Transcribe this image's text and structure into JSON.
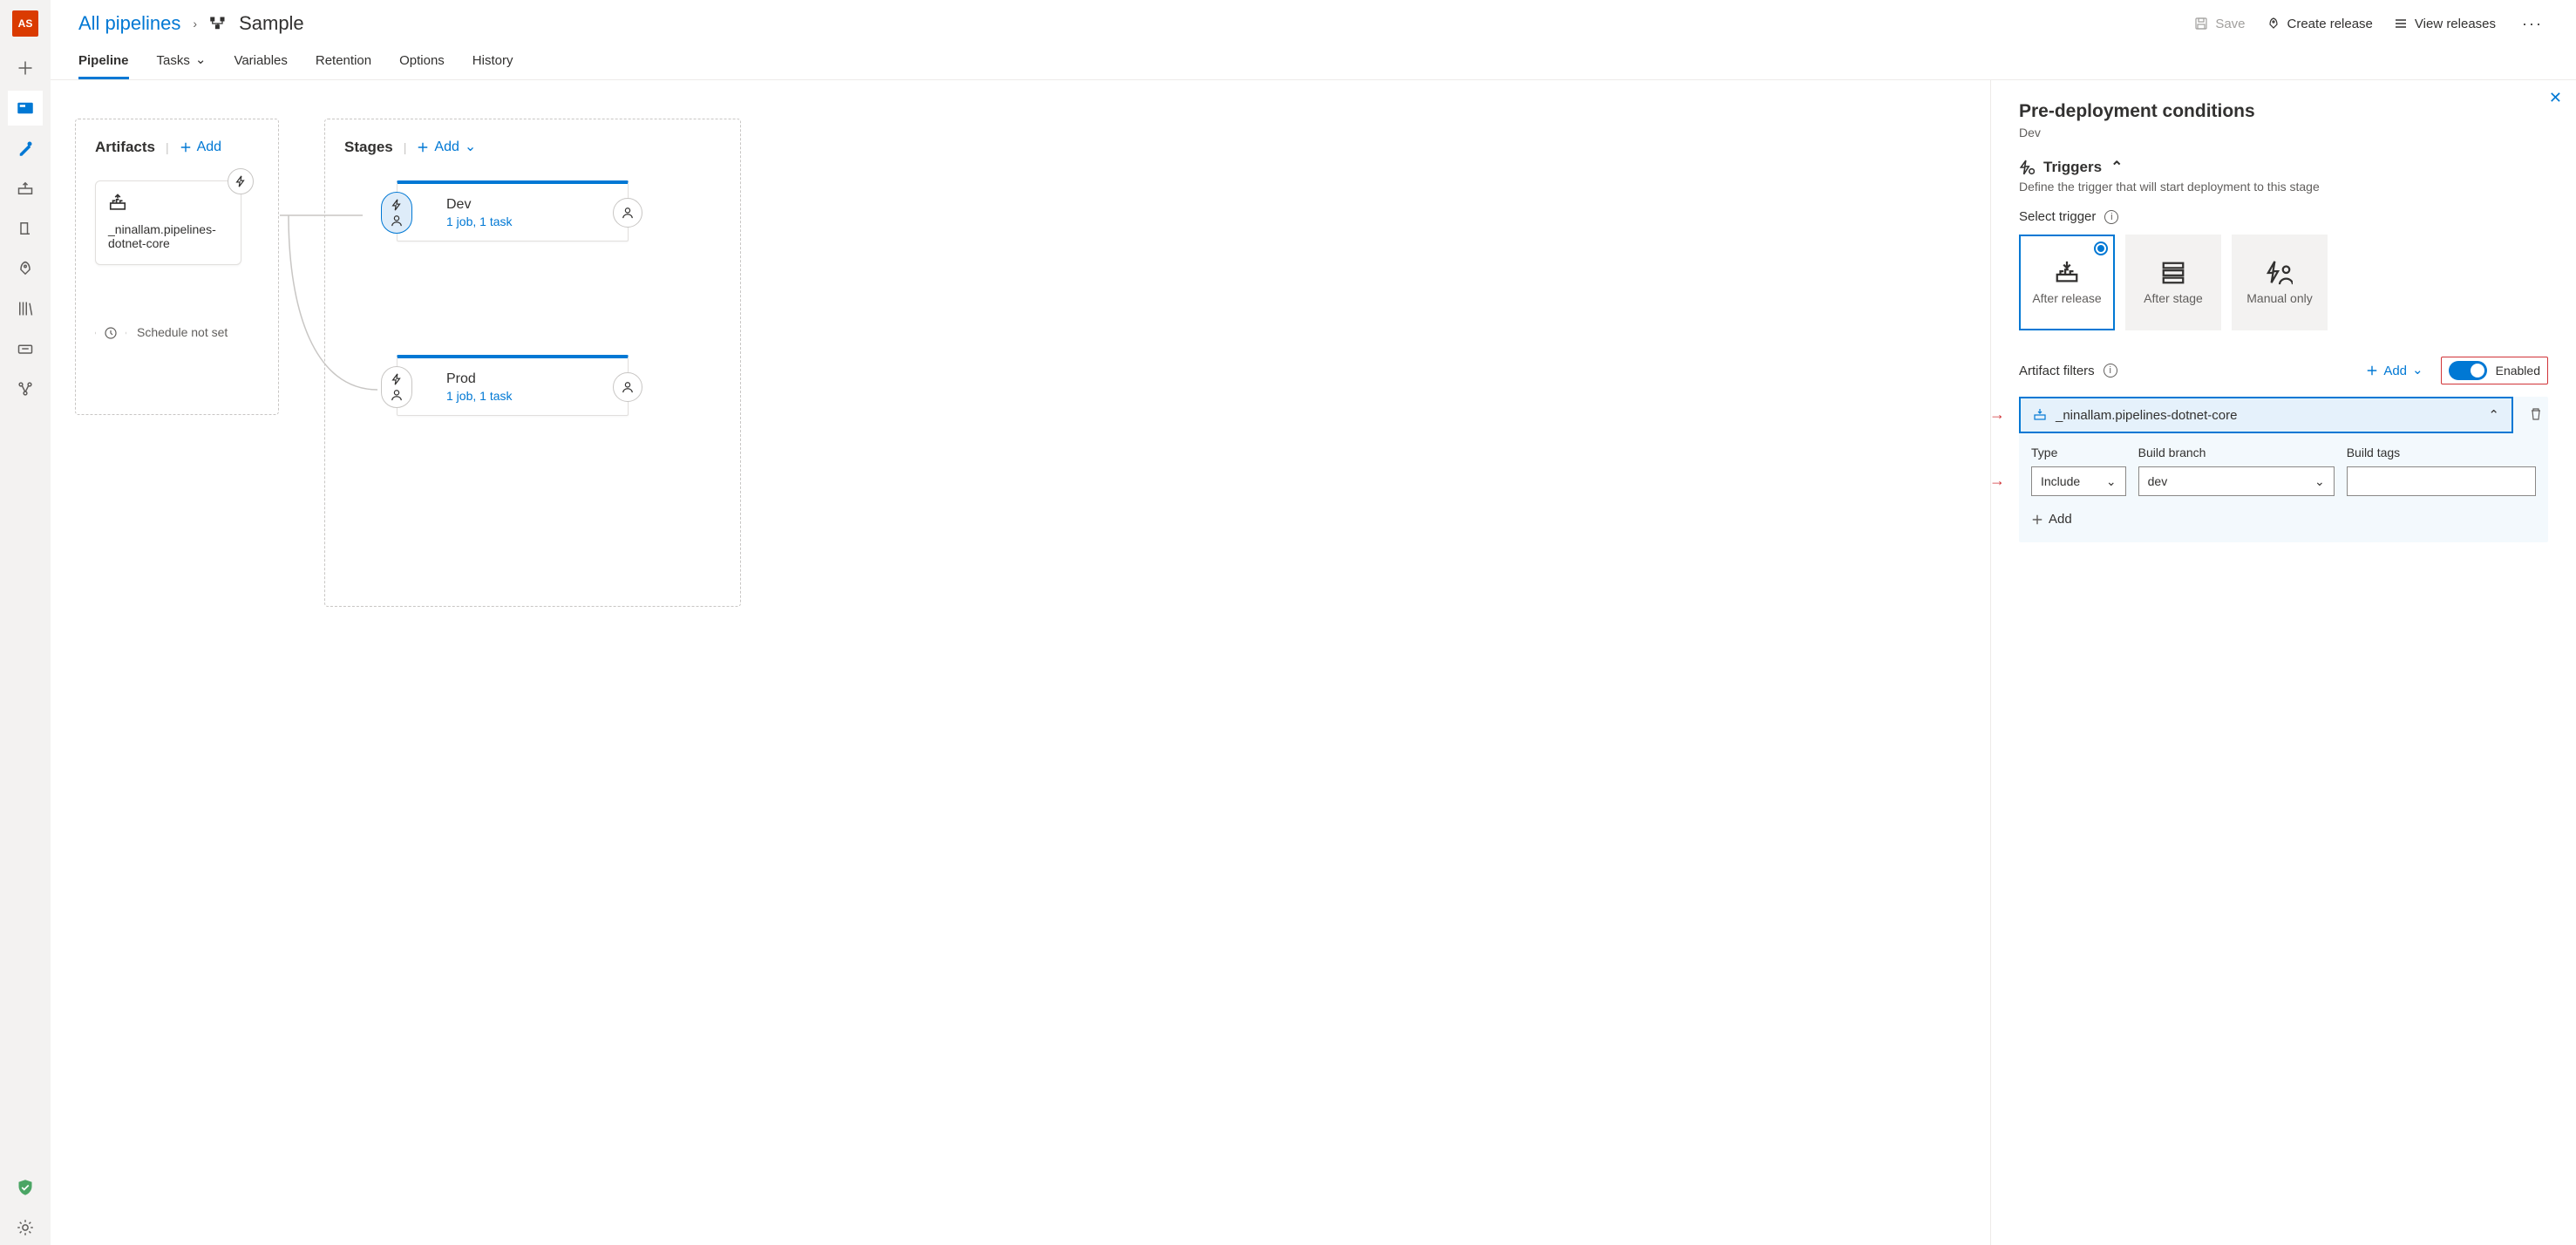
{
  "user_initials": "AS",
  "breadcrumb": {
    "root": "All pipelines",
    "current": "Sample"
  },
  "header_actions": {
    "save": "Save",
    "create_release": "Create release",
    "view_releases": "View releases"
  },
  "tabs": {
    "pipeline": "Pipeline",
    "tasks": "Tasks",
    "variables": "Variables",
    "retention": "Retention",
    "options": "Options",
    "history": "History"
  },
  "canvas": {
    "artifacts_title": "Artifacts",
    "stages_title": "Stages",
    "add_label": "Add",
    "artifact_name": "_ninallam.pipelines-dotnet-core",
    "schedule_label": "Schedule not set",
    "stages": [
      {
        "name": "Dev",
        "sub": "1 job, 1 task"
      },
      {
        "name": "Prod",
        "sub": "1 job, 1 task"
      }
    ]
  },
  "panel": {
    "title": "Pre-deployment conditions",
    "stage": "Dev",
    "triggers_title": "Triggers",
    "triggers_desc": "Define the trigger that will start deployment to this stage",
    "select_trigger": "Select trigger",
    "trigger_options": {
      "after_release": "After release",
      "after_stage": "After stage",
      "manual_only": "Manual only"
    },
    "artifact_filters_label": "Artifact filters",
    "add_label": "Add",
    "enabled_label": "Enabled",
    "filter_source": "_ninallam.pipelines-dotnet-core",
    "form": {
      "type_label": "Type",
      "branch_label": "Build branch",
      "tags_label": "Build tags",
      "type_value": "Include",
      "branch_value": "dev",
      "tags_value": ""
    },
    "add_row": "Add"
  }
}
